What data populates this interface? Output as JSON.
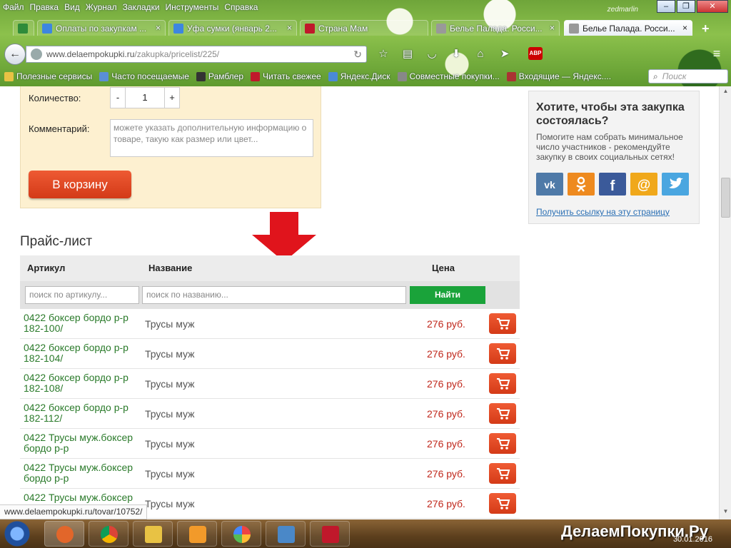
{
  "browser": {
    "menu": [
      "Файл",
      "Правка",
      "Вид",
      "Журнал",
      "Закладки",
      "Инструменты",
      "Справка"
    ],
    "brand_mark": "zedmarlin",
    "window_controls": {
      "minimize": "–",
      "maximize": "❐",
      "close": "✕"
    },
    "tabs": [
      {
        "label": "",
        "icon_color": "#2e8b3a"
      },
      {
        "label": "Оплаты по закупкам ...",
        "icon_color": "#3d86e0"
      },
      {
        "label": "Уфа сумки (январь 2...",
        "icon_color": "#3d86e0"
      },
      {
        "label": "Страна Мам",
        "icon_color": "#c0182b"
      },
      {
        "label": "Белье Палада. Росси...",
        "icon_color": "#999999"
      },
      {
        "label": "Белье Палада. Росси...",
        "icon_color": "#999999",
        "active": true
      }
    ],
    "new_tab": "+",
    "tab_close": "×",
    "url_host": "www.delaempokupki.ru",
    "url_path": "/zakupka/pricelist/225/",
    "reload": "↻",
    "back": "←",
    "abp_label": "ABP",
    "menu_icon": "≡",
    "nav_icons": [
      "star-icon",
      "reading-list-icon",
      "pocket-icon",
      "download-icon",
      "home-icon",
      "send-icon"
    ],
    "bookmarks": [
      {
        "label": "Полезные сервисы",
        "icon_color": "#e8c244"
      },
      {
        "label": "Часто посещаемые",
        "icon_color": "#5a8fd6"
      },
      {
        "label": "Рамблер",
        "icon_color": "#333333"
      },
      {
        "label": "Читать свежее",
        "icon_color": "#c0182b"
      },
      {
        "label": "Яндекс.Диск",
        "icon_color": "#4a8ad8"
      },
      {
        "label": "Совместные покупки...",
        "icon_color": "#888888"
      },
      {
        "label": "Входящие — Яндекс....",
        "icon_color": "#aa3333"
      }
    ],
    "search_placeholder": "Поиск",
    "status_url": "www.delaempokupki.ru/tovar/10752/"
  },
  "product_form": {
    "qty_label": "Количество:",
    "qty_minus": "-",
    "qty_value": "1",
    "qty_plus": "+",
    "comment_label": "Комментарий:",
    "comment_placeholder": "можете указать дополнительную информацию о товаре, такую как размер или цвет...",
    "to_cart_label": "В корзину"
  },
  "pricelist": {
    "title": "Прайс-лист",
    "columns": {
      "article": "Артикул",
      "name": "Название",
      "price": "Цена"
    },
    "filter": {
      "article_placeholder": "поиск по артикулу...",
      "name_placeholder": "поиск по названию...",
      "find_label": "Найти"
    },
    "rows": [
      {
        "article": "0422 боксер бордо р-р 182-100/",
        "name": "Трусы муж",
        "price": "276 руб."
      },
      {
        "article": "0422 боксер бордо р-р 182-104/",
        "name": "Трусы муж",
        "price": "276 руб."
      },
      {
        "article": "0422 боксер бордо р-р 182-108/",
        "name": "Трусы муж",
        "price": "276 руб."
      },
      {
        "article": "0422 боксер бордо р-р 182-112/",
        "name": "Трусы муж",
        "price": "276 руб."
      },
      {
        "article": "0422 Трусы муж.боксер бордо р-р",
        "name": "Трусы муж",
        "price": "276 руб."
      },
      {
        "article": "0422 Трусы муж.боксер бордо р-р",
        "name": "Трусы муж",
        "price": "276 руб."
      },
      {
        "article": "0422 Трусы муж.боксер",
        "name": "Трусы муж",
        "price": "276 руб."
      }
    ]
  },
  "sidebar": {
    "title": "Хотите, чтобы эта закупка состоялась?",
    "text": "Помогите нам собрать минимальное число участников - рекомендуйте закупку в своих социальных сетях!",
    "social": [
      {
        "name": "vk-icon",
        "glyph": "vk",
        "color": "#4f7aa8"
      },
      {
        "name": "odnoklassniki-icon",
        "glyph": "ok",
        "color": "#ee8a1f"
      },
      {
        "name": "facebook-icon",
        "glyph": "f",
        "color": "#3b5a9a"
      },
      {
        "name": "mailru-icon",
        "glyph": "@",
        "color": "#f0a81b"
      },
      {
        "name": "twitter-icon",
        "glyph": "t",
        "color": "#4aa6e0"
      }
    ],
    "link": "Получить ссылку на эту страницу"
  },
  "taskbar": {
    "watermark": "ДелаемПокупки.Ру",
    "date": "30.01.2016",
    "apps": [
      {
        "name": "firefox-icon",
        "color": "#e2662a"
      },
      {
        "name": "chrome-icon",
        "color": "#e8c62a"
      },
      {
        "name": "explorer-folder-icon",
        "color": "#e8c244"
      },
      {
        "name": "media-player-icon",
        "color": "#f29a2a"
      },
      {
        "name": "picasa-icon",
        "color": "#7ab84a"
      },
      {
        "name": "photo-viewer-icon",
        "color": "#4a88c8"
      },
      {
        "name": "image-editor-icon",
        "color": "#c0182b"
      }
    ]
  },
  "colors": {
    "accent_red": "#d33a18",
    "link_green": "#2a7a2a",
    "find_green": "#1aa33a",
    "price_red": "#c0281c"
  }
}
